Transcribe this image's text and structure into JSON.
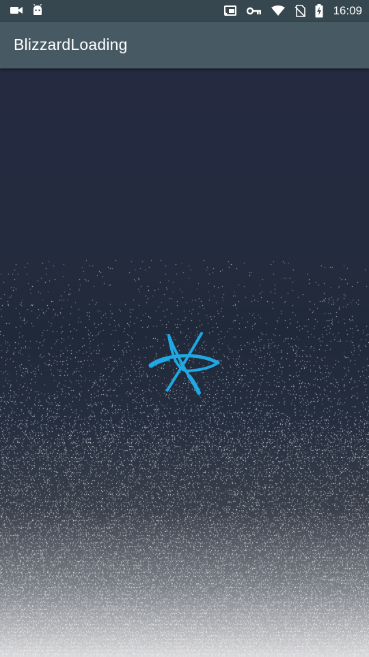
{
  "status_bar": {
    "time": "16:09",
    "left_icons": [
      "video-camera-icon",
      "android-icon"
    ],
    "right_icons": [
      "cast-icon",
      "vpn-key-icon",
      "wifi-icon",
      "no-sim-icon",
      "battery-charging-icon"
    ]
  },
  "app_bar": {
    "title": "BlizzardLoading",
    "color": "#475a63"
  },
  "loading_logo": {
    "icon": "blizzard-star-icon",
    "color": "#1fa8e4"
  },
  "colors": {
    "status_bar": "#36474f",
    "background_top": "#252a41",
    "snow": "#ffffff"
  }
}
